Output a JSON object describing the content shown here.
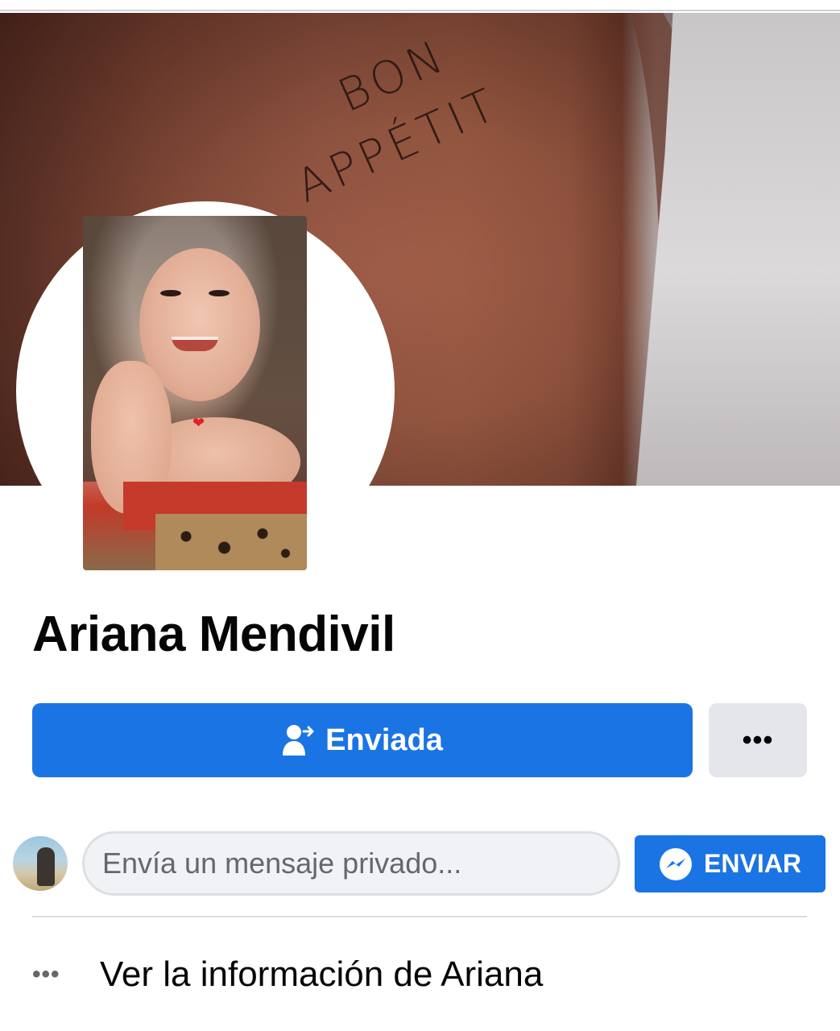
{
  "cover": {
    "tattoo_line1": "BON",
    "tattoo_line2": "APPÉTIT"
  },
  "profile": {
    "name": "Ariana Mendivil",
    "heart_emoji": "❤"
  },
  "actions": {
    "friend_request_label": "Enviada",
    "more_label": "•••"
  },
  "message": {
    "placeholder": "Envía un mensaje privado...",
    "send_label": "ENVIAR"
  },
  "info": {
    "dots": "•••",
    "label": "Ver la información de Ariana"
  },
  "colors": {
    "primary": "#1b74e4",
    "secondary_button": "#e4e6eb",
    "text": "#050505",
    "muted_text": "#65676b"
  },
  "icons": {
    "friend_request": "person-arrow-icon",
    "messenger": "messenger-icon",
    "more": "more-dots-icon"
  }
}
